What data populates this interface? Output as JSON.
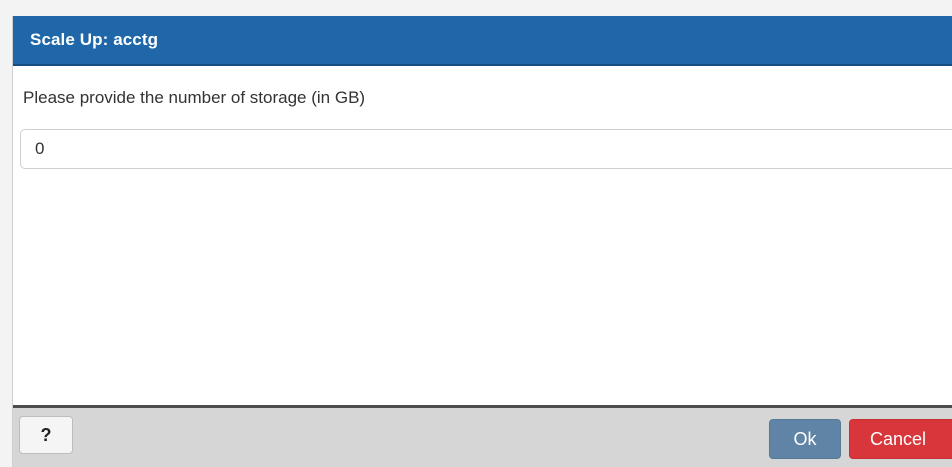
{
  "dialog": {
    "title": "Scale Up: acctg",
    "prompt": "Please provide the number of storage (in GB)",
    "storage_input": {
      "value": "0",
      "placeholder": ""
    },
    "buttons": {
      "help_label": "?",
      "ok_label": "Ok",
      "cancel_label": "Cancel"
    }
  },
  "colors": {
    "title_bar": "#1f67a8",
    "ok_button": "#5f84a5",
    "cancel_button": "#d9363c",
    "footer": "#d6d6d6"
  }
}
